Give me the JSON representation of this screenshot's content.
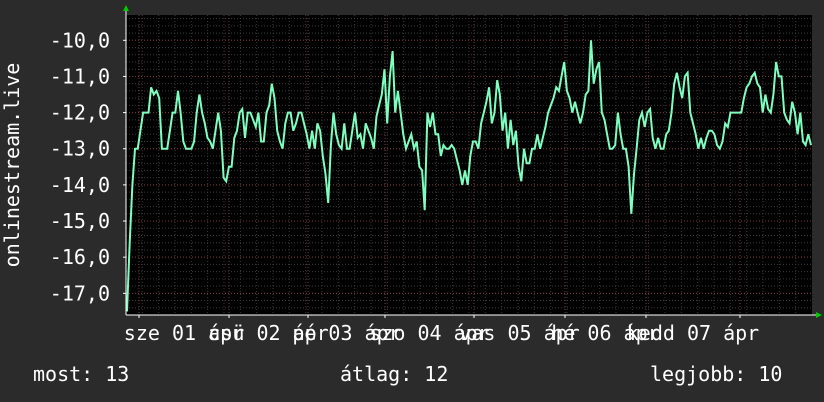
{
  "chart_data": {
    "type": "line",
    "ylabel": "onlinestream.live",
    "ylim": [
      -17.6,
      -9.3
    ],
    "y_ticks": [
      "-10,0",
      "-11,0",
      "-12,0",
      "-13,0",
      "-14,0",
      "-15,0",
      "-16,0",
      "-17,0"
    ],
    "y_tick_values": [
      -10,
      -11,
      -12,
      -13,
      -14,
      -15,
      -16,
      -17
    ],
    "x_ticks": [
      "sze 01 ápr",
      "csü 02 ápr",
      "pé 03 ápr",
      "szo 04 ápr",
      "vas 05 ápr",
      "hé 06 ápr",
      "kedd 07 ápr"
    ],
    "grid": true,
    "line_color": "#7fffbf",
    "series": [
      {
        "values": [
          -17.5,
          -15.6,
          -14.0,
          -13.0,
          -13.0,
          -12.5,
          -12.0,
          -12.0,
          -12.0,
          -11.3,
          -11.5,
          -11.4,
          -11.6,
          -13.0,
          -13.0,
          -13.0,
          -12.5,
          -12.0,
          -12.0,
          -11.4,
          -12.0,
          -12.8,
          -13.0,
          -13.0,
          -13.0,
          -12.8,
          -12.0,
          -11.5,
          -12.0,
          -12.3,
          -12.7,
          -12.8,
          -13.0,
          -12.5,
          -12.0,
          -12.5,
          -13.8,
          -13.9,
          -13.5,
          -13.5,
          -12.7,
          -12.5,
          -12.0,
          -11.9,
          -12.7,
          -12.0,
          -12.0,
          -12.2,
          -12.4,
          -12.0,
          -12.8,
          -12.8,
          -12.0,
          -11.8,
          -11.2,
          -11.6,
          -12.5,
          -12.8,
          -13.0,
          -12.3,
          -12.0,
          -12.0,
          -12.5,
          -12.3,
          -12.0,
          -12.0,
          -12.3,
          -12.6,
          -13.0,
          -12.5,
          -13.0,
          -12.3,
          -12.5,
          -13.2,
          -13.7,
          -14.5,
          -12.9,
          -12.0,
          -12.6,
          -12.9,
          -13.0,
          -12.3,
          -13.0,
          -13.0,
          -12.5,
          -12.0,
          -12.7,
          -12.6,
          -13.0,
          -12.3,
          -12.5,
          -12.7,
          -13.0,
          -12.1,
          -11.8,
          -11.5,
          -10.8,
          -12.3,
          -11.0,
          -10.3,
          -12.0,
          -11.4,
          -12.0,
          -12.6,
          -13.0,
          -12.8,
          -12.6,
          -13.0,
          -12.8,
          -13.5,
          -13.6,
          -14.7,
          -12.0,
          -12.4,
          -12.0,
          -12.6,
          -12.6,
          -13.2,
          -12.9,
          -13.0,
          -13.0,
          -12.9,
          -13.0,
          -13.3,
          -13.6,
          -14.0,
          -13.6,
          -14.0,
          -13.2,
          -12.8,
          -12.8,
          -13.0,
          -12.3,
          -12.0,
          -11.7,
          -11.3,
          -12.3,
          -12.0,
          -11.1,
          -11.5,
          -12.5,
          -12.0,
          -13.0,
          -12.2,
          -12.9,
          -12.5,
          -13.5,
          -13.9,
          -13.0,
          -13.4,
          -13.4,
          -13.0,
          -13.0,
          -12.6,
          -13.0,
          -12.7,
          -12.4,
          -12.0,
          -11.8,
          -11.6,
          -11.3,
          -11.4,
          -11.0,
          -10.6,
          -11.4,
          -11.6,
          -12.0,
          -11.7,
          -12.0,
          -12.3,
          -12.0,
          -11.5,
          -11.4,
          -10.0,
          -11.2,
          -10.8,
          -10.6,
          -12.0,
          -12.2,
          -12.6,
          -13.0,
          -13.0,
          -12.9,
          -12.0,
          -12.6,
          -13.0,
          -13.0,
          -13.5,
          -14.8,
          -13.7,
          -13.0,
          -12.2,
          -12.0,
          -12.4,
          -12.0,
          -11.9,
          -12.7,
          -13.0,
          -12.7,
          -13.0,
          -13.0,
          -12.6,
          -12.5,
          -12.0,
          -11.2,
          -10.9,
          -11.3,
          -11.6,
          -11.0,
          -10.9,
          -12.0,
          -12.3,
          -12.6,
          -13.0,
          -12.7,
          -13.0,
          -12.7,
          -12.5,
          -12.5,
          -12.6,
          -12.9,
          -13.0,
          -12.8,
          -12.3,
          -12.4,
          -12.0,
          -12.0,
          -12.0,
          -12.0,
          -12.0,
          -11.6,
          -11.3,
          -11.2,
          -11.0,
          -10.9,
          -11.2,
          -11.3,
          -12.0,
          -11.5,
          -11.9,
          -12.0,
          -11.5,
          -10.6,
          -11.0,
          -11.0,
          -12.0,
          -12.2,
          -12.3,
          -11.7,
          -12.0,
          -12.6,
          -12.0,
          -12.8,
          -12.9,
          -12.6,
          -12.9
        ]
      }
    ]
  },
  "stats": {
    "current_label": "most: 13",
    "average_label": "átlag: 12",
    "best_label": "legjobb: 10"
  }
}
